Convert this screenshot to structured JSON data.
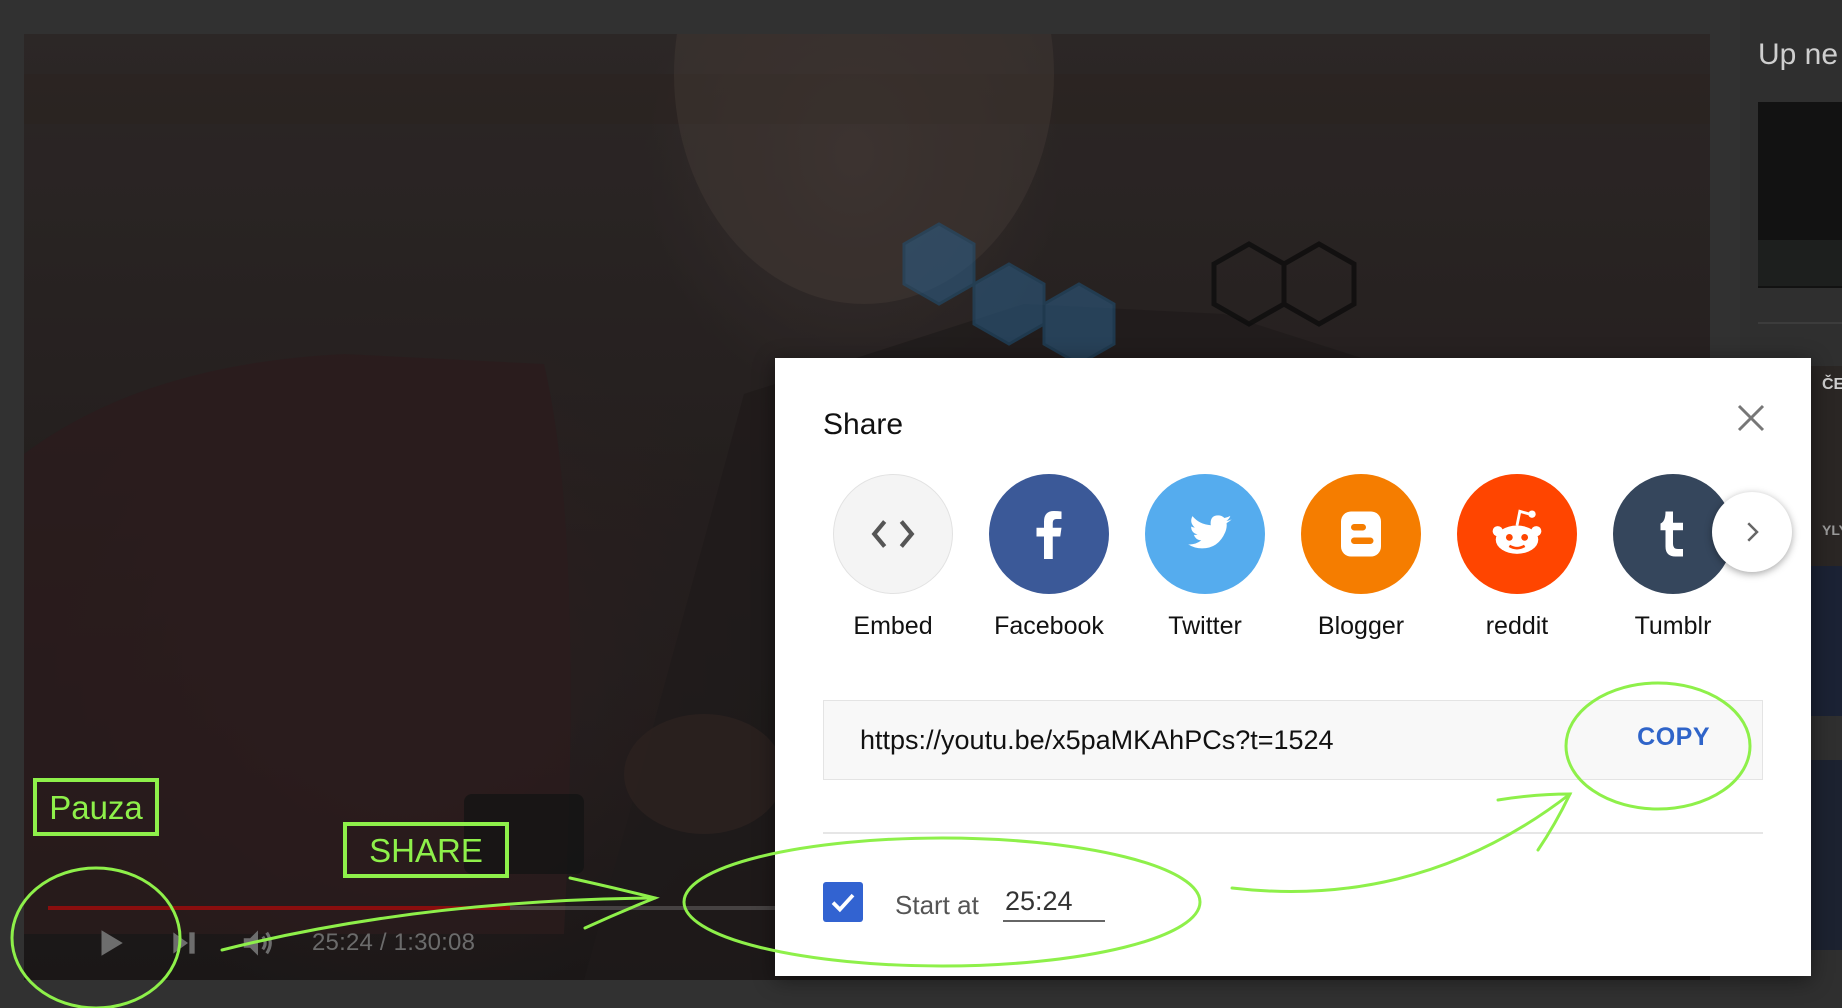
{
  "player": {
    "time_current": "25:24",
    "time_total": "1:30:08",
    "time_display": "25:24 / 1:30:08",
    "progress_fraction": 0.2818
  },
  "sidebar": {
    "up_next_label": "Up ne",
    "thumb2_text_top": "ČER",
    "thumb2_text_bottom": "YLY"
  },
  "share": {
    "title": "Share",
    "targets": [
      {
        "label": "Embed",
        "icon": "embed-icon",
        "color": "#f4f4f4"
      },
      {
        "label": "Facebook",
        "icon": "facebook-icon",
        "color": "#3b5998"
      },
      {
        "label": "Twitter",
        "icon": "twitter-icon",
        "color": "#55acee"
      },
      {
        "label": "Blogger",
        "icon": "blogger-icon",
        "color": "#f57d00"
      },
      {
        "label": "reddit",
        "icon": "reddit-icon",
        "color": "#ff4500"
      },
      {
        "label": "Tumblr",
        "icon": "tumblr-icon",
        "color": "#35465c"
      }
    ],
    "url": "https://youtu.be/x5paMKAhPCs?t=1524",
    "copy_label": "COPY",
    "start_at_label": "Start at",
    "start_at_value": "25:24",
    "start_at_checked": true,
    "accent_color": "#3263d1"
  },
  "annotations": {
    "pauza": "Pauza",
    "share": "SHARE",
    "color": "#8ef04a"
  }
}
